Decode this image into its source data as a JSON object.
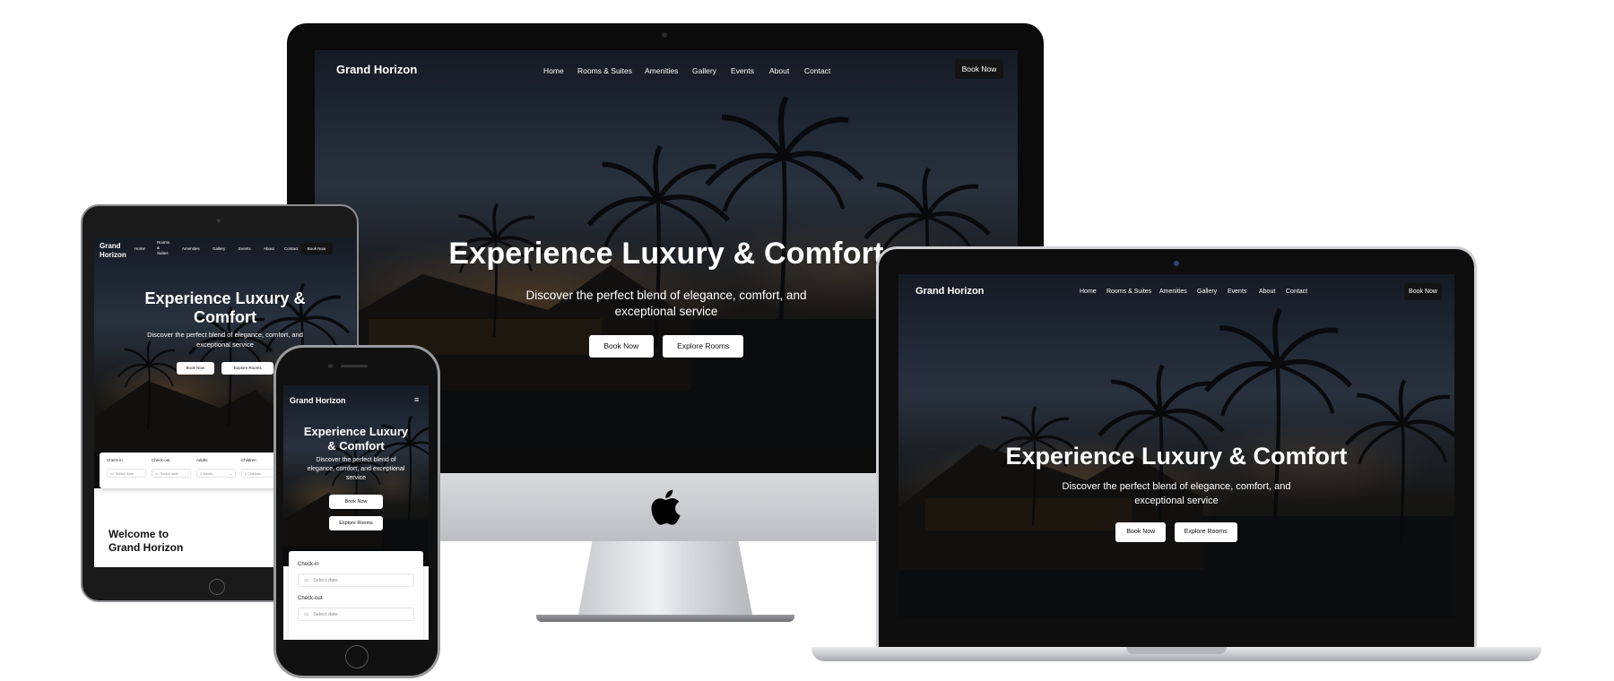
{
  "site": {
    "brand": "Grand Horizon",
    "brand_line1": "Grand",
    "brand_line2": "Horizon",
    "nav": {
      "home": "Home",
      "rooms": "Rooms & Suites",
      "rooms_l1": "Rooms",
      "rooms_l2": "&",
      "rooms_l3": "Suites",
      "amenities": "Amenities",
      "gallery": "Gallery",
      "events": "Events",
      "about": "About",
      "contact": "Contact"
    },
    "nav_cta": "Book Now",
    "hero": {
      "title": "Experience Luxury & Comfort",
      "title_l1": "Experience Luxury &",
      "title_l2": "Comfort",
      "phone_title_l1": "Experience Luxury",
      "phone_title_l2": "& Comfort",
      "subtitle_l1": "Discover the perfect blend of elegance, comfort, and",
      "subtitle_l2": "exceptional service",
      "phone_sub_l1": "Discover the perfect blend of",
      "phone_sub_l2": "elegance, comfort, and exceptional",
      "phone_sub_l3": "service",
      "primary_cta": "Book Now",
      "secondary_cta": "Explore Rooms"
    },
    "booking": {
      "checkin_label": "Check-in",
      "checkout_label": "Check-out",
      "adults_label": "Adults",
      "children_label": "Children",
      "date_placeholder": "Select date",
      "adults_value": "2 Adults",
      "children_value": "0 Children"
    },
    "welcome_l1": "Welcome to",
    "welcome_l2": "Grand Horizon"
  },
  "colors": {
    "nav_button_bg": "#141414",
    "hero_overlay": "#1f2836",
    "accent_light": "#ffb25c"
  },
  "icons": [
    "calendar-icon",
    "chevron-down-icon",
    "menu-icon",
    "apple-logo-icon",
    "camera-icon"
  ]
}
